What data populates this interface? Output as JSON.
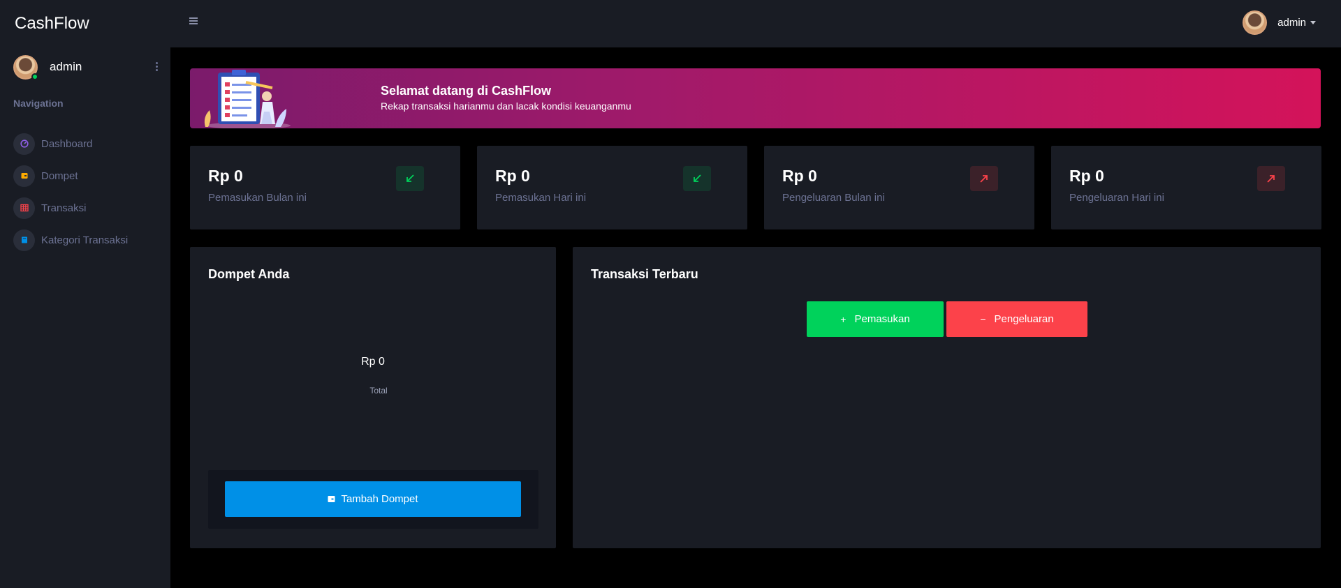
{
  "brand": "CashFlow",
  "profile": {
    "name": "admin"
  },
  "nav": {
    "title": "Navigation",
    "items": [
      {
        "label": "Dashboard",
        "icon": "speedometer-icon",
        "color": "#8f5fe8"
      },
      {
        "label": "Dompet",
        "icon": "wallet-icon",
        "color": "#ffab00"
      },
      {
        "label": "Transaksi",
        "icon": "table-icon",
        "color": "#fc424a"
      },
      {
        "label": "Kategori Transaksi",
        "icon": "book-icon",
        "color": "#0090e7"
      }
    ]
  },
  "topbar": {
    "user_name": "admin"
  },
  "banner": {
    "title": "Selamat datang di CashFlow",
    "subtitle": "Rekap transaksi harianmu dan lacak kondisi keuanganmu"
  },
  "stats": [
    {
      "value": "Rp 0",
      "label": "Pemasukan Bulan ini",
      "type": "income",
      "icon": "arrow-bottom-left-icon"
    },
    {
      "value": "Rp 0",
      "label": "Pemasukan Hari ini",
      "type": "income",
      "icon": "arrow-bottom-left-icon"
    },
    {
      "value": "Rp 0",
      "label": "Pengeluaran Bulan ini",
      "type": "expense",
      "icon": "arrow-top-right-icon"
    },
    {
      "value": "Rp 0",
      "label": "Pengeluaran Hari ini",
      "type": "expense",
      "icon": "arrow-top-right-icon"
    }
  ],
  "wallet": {
    "title": "Dompet Anda",
    "total_value": "Rp 0",
    "total_label": "Total",
    "add_button": "Tambah Dompet"
  },
  "transactions": {
    "title": "Transaksi Terbaru",
    "income_button": "Pemasukan",
    "expense_button": "Pengeluaran"
  },
  "colors": {
    "income": "#00d25b",
    "expense": "#fc424a",
    "primary": "#0090e7",
    "card_bg": "#191c24",
    "muted_text": "#6c7293"
  }
}
